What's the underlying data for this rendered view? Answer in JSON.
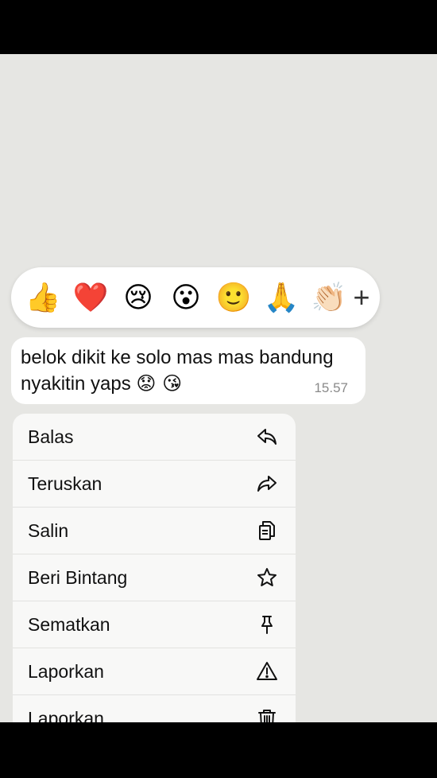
{
  "reactions": {
    "emojis": [
      "👍",
      "❤️",
      "😢",
      "😮",
      "🙂",
      "🙏",
      "👏🏻"
    ],
    "more_label": "+"
  },
  "message": {
    "text": "belok dikit ke solo mas mas bandung nyakitin yaps",
    "emojis": "😟 😘",
    "time": "15.57"
  },
  "menu": {
    "items": [
      {
        "label": "Balas",
        "icon": "reply-icon"
      },
      {
        "label": "Teruskan",
        "icon": "forward-icon"
      },
      {
        "label": "Salin",
        "icon": "copy-icon"
      },
      {
        "label": "Beri Bintang",
        "icon": "star-icon"
      },
      {
        "label": "Sematkan",
        "icon": "pin-icon"
      },
      {
        "label": "Laporkan",
        "icon": "warning-icon"
      },
      {
        "label": "Laporkan",
        "icon": "trash-icon"
      }
    ]
  }
}
